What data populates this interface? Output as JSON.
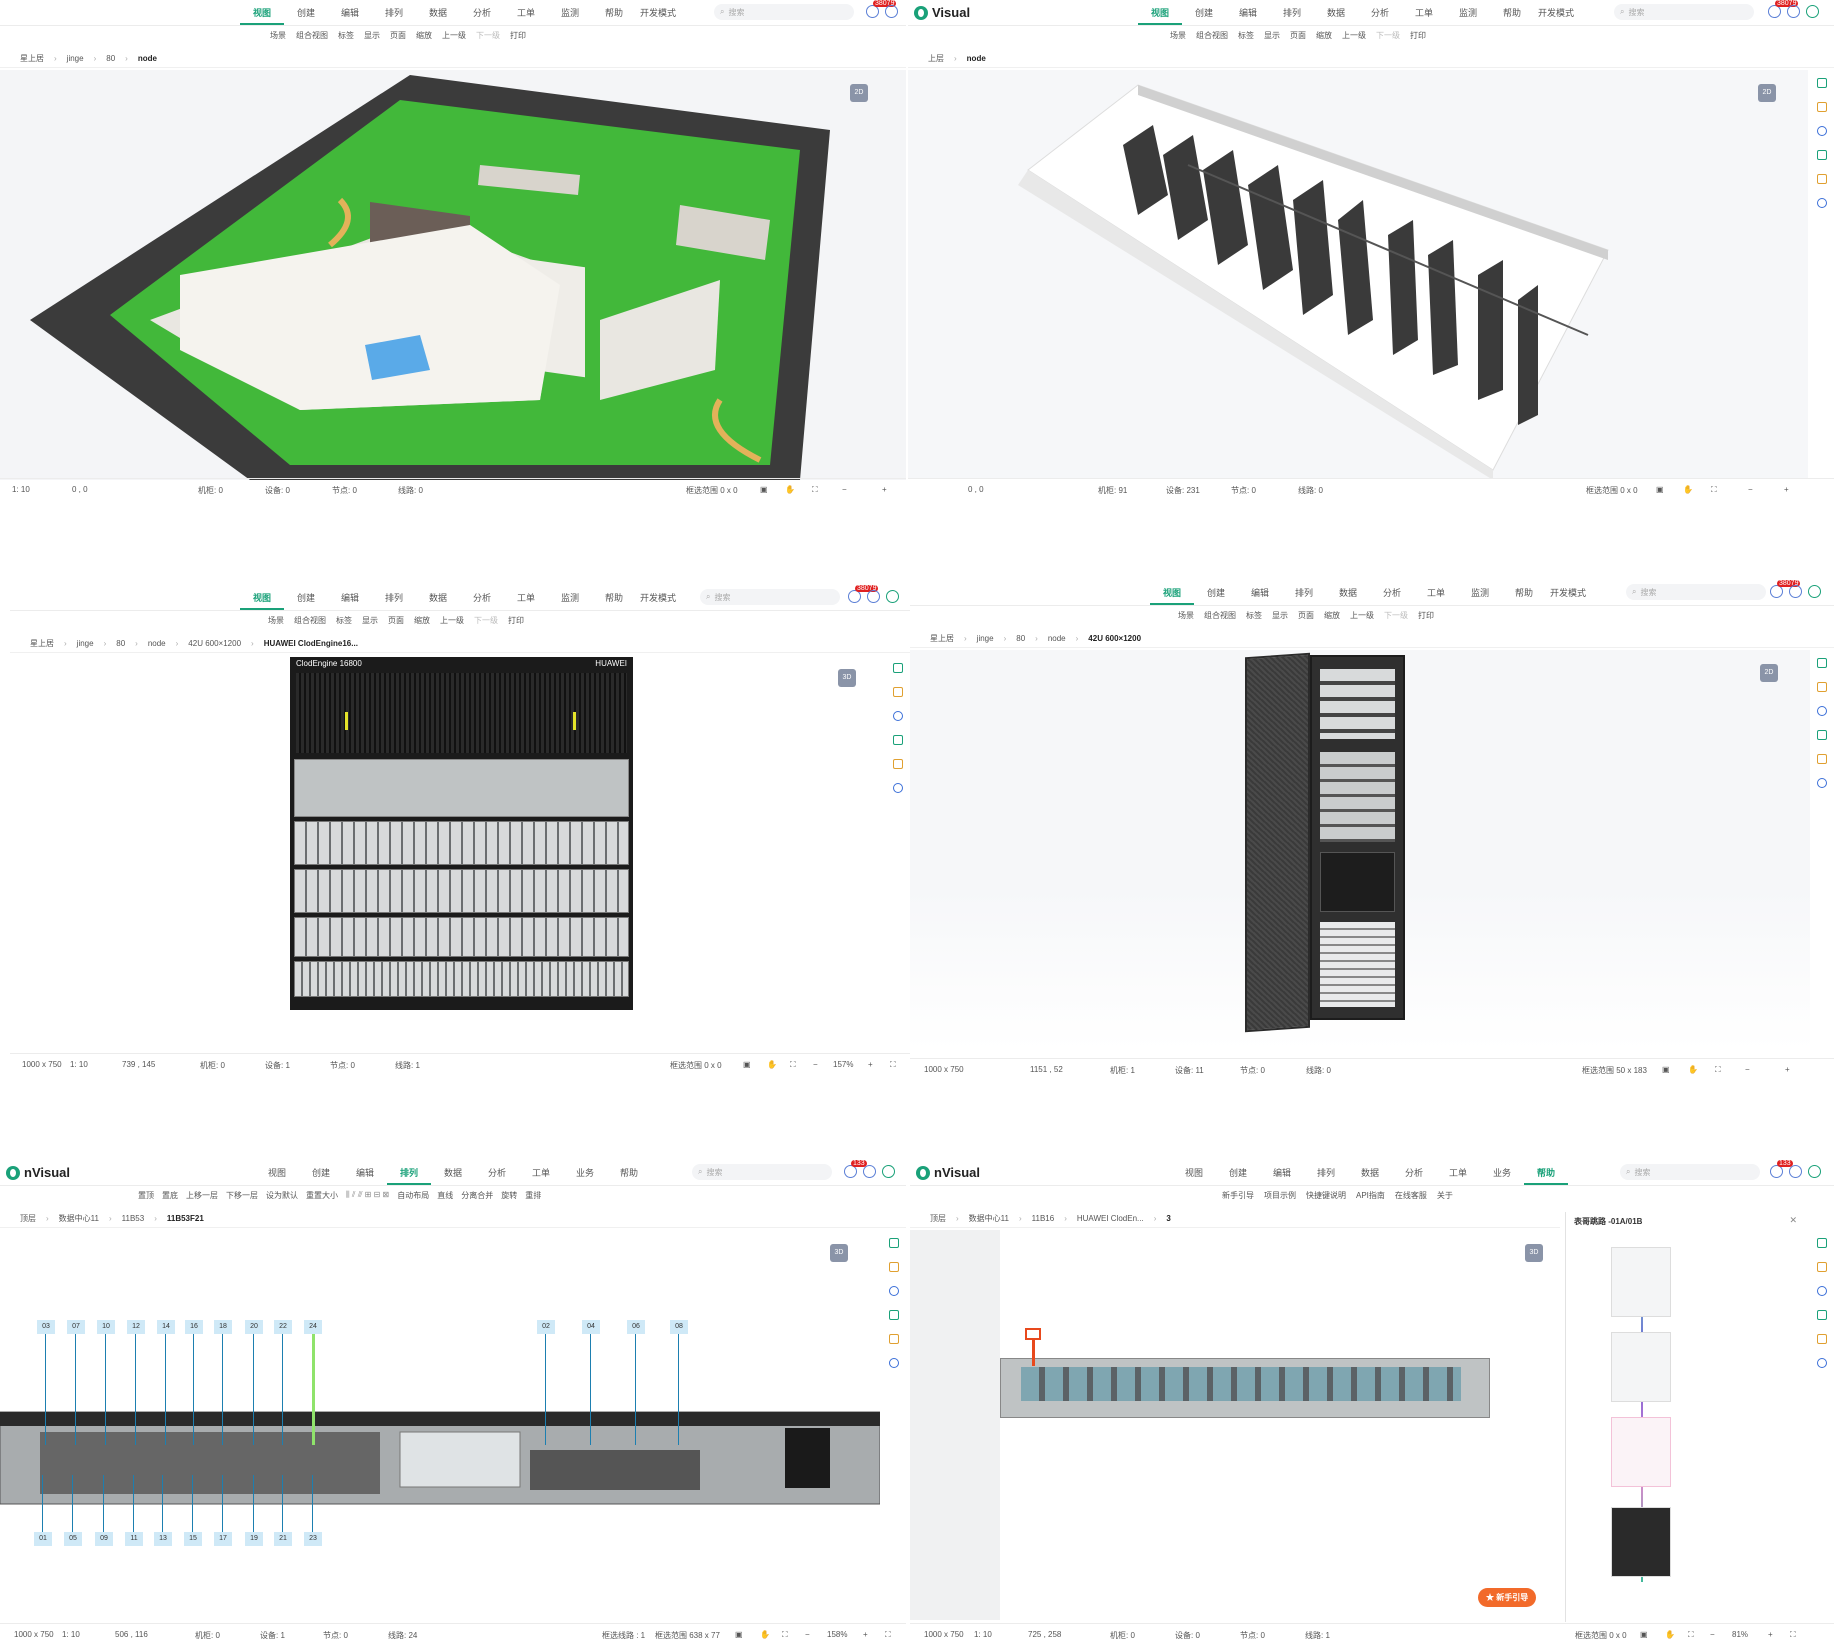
{
  "menus_a": [
    "视图",
    "创建",
    "编辑",
    "排列",
    "数据",
    "分析",
    "工单",
    "监测",
    "帮助",
    "开发模式"
  ],
  "menus_b": [
    "视图",
    "创建",
    "编辑",
    "排列",
    "数据",
    "分析",
    "工单",
    "业务",
    "帮助"
  ],
  "toolbar_view": [
    "场景",
    "组合视图",
    "标签",
    "显示",
    "页面",
    "缩放",
    "上一级",
    "下一级",
    "打印"
  ],
  "toolbar_arrange": [
    "置顶",
    "置底",
    "上移一层",
    "下移一层",
    "设为默认",
    "重置大小",
    "自动布局",
    "直线",
    "分离合并",
    "旋转",
    "重排"
  ],
  "toolbar_help": [
    "新手引导",
    "项目示例",
    "快捷键说明",
    "API指南",
    "在线客服",
    "关于"
  ],
  "search_placeholder": "搜索",
  "brand": "nVisual",
  "brand_cut": "Visual",
  "badge_a": "38079",
  "badge_b": "133",
  "panels": {
    "p1": {
      "crumbs": [
        "星上居",
        "jinge",
        "80",
        "node"
      ],
      "view_toggle": "2D",
      "status": {
        "scale": "1: 10",
        "coord": "0 , 0",
        "rack": "机柜: 0",
        "device": "设备: 0",
        "node": "节点: 0",
        "line": "线路: 0",
        "select": "框选范围 0 x 0"
      }
    },
    "p2": {
      "crumbs": [
        "上层",
        "node"
      ],
      "view_toggle": "2D",
      "status": {
        "coord": "0 , 0",
        "rack": "机柜: 91",
        "device": "设备: 231",
        "node": "节点: 0",
        "line": "线路: 0",
        "select": "框选范围 0 x 0"
      }
    },
    "p3": {
      "crumbs": [
        "星上居",
        "jinge",
        "80",
        "node",
        "42U 600×1200",
        "HUAWEI ClodEngine16..."
      ],
      "view_toggle": "3D",
      "device_title": "ClodEngine 16800",
      "device_brand": "HUAWEI",
      "status": {
        "size": "1000 x 750",
        "scale": "1: 10",
        "coord": "739 , 145",
        "rack": "机柜: 0",
        "device": "设备: 1",
        "node": "节点: 0",
        "line": "线路: 1",
        "select": "框选范围 0 x 0",
        "zoom": "157%"
      }
    },
    "p4": {
      "crumbs": [
        "星上居",
        "jinge",
        "80",
        "node",
        "42U 600×1200"
      ],
      "view_toggle": "2D",
      "status": {
        "size": "1000 x 750",
        "coord": "1151 , 52",
        "rack": "机柜: 1",
        "device": "设备: 11",
        "node": "节点: 0",
        "line": "线路: 0",
        "select": "框选范围 50 x 183"
      }
    },
    "p5": {
      "crumbs": [
        "顶层",
        "数据中心11",
        "11B53",
        "11B53F21"
      ],
      "view_toggle": "3D",
      "top_ports": [
        "03",
        "07",
        "10",
        "12",
        "14",
        "16",
        "18",
        "20",
        "22",
        "24",
        "02",
        "04",
        "06",
        "08"
      ],
      "bottom_ports": [
        "01",
        "05",
        "09",
        "11",
        "13",
        "15",
        "17",
        "19",
        "21",
        "23"
      ],
      "status": {
        "size": "1000 x 750",
        "scale": "1: 10",
        "coord": "506 , 116",
        "rack": "机柜: 0",
        "device": "设备: 1",
        "node": "节点: 0",
        "line": "线路: 24",
        "select_line": "框选线路 : 1",
        "select": "框选范围 638 x 77",
        "zoom": "158%"
      }
    },
    "p6": {
      "crumbs": [
        "顶层",
        "数据中心11",
        "11B16",
        "HUAWEI ClodEn...",
        "3"
      ],
      "view_toggle": "3D",
      "side_title": "表哥跳路 -01A/01B",
      "guide_button": "新手引导",
      "status": {
        "size": "1000 x 750",
        "scale": "1: 10",
        "coord": "725 , 258",
        "rack": "机柜: 0",
        "device": "设备: 0",
        "node": "节点: 0",
        "line": "线路: 1",
        "select": "框选范围 0 x 0",
        "zoom": "81%"
      }
    }
  },
  "colors": {
    "accent": "#1aa179",
    "grass": "#3fc63a",
    "road": "#4a4a4a",
    "rack": "#3a3a3a",
    "port_line": "#1d7fb0",
    "highlight": "#e8491d"
  }
}
